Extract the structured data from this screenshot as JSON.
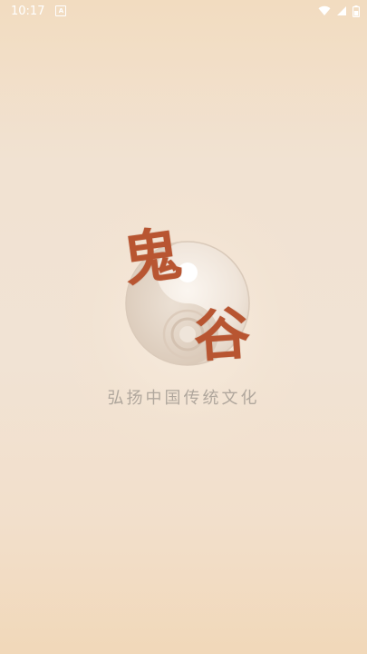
{
  "status_bar": {
    "time": "10:17",
    "notification_glyph": "A",
    "icons": [
      "wifi-icon",
      "signal-icon",
      "battery-icon"
    ]
  },
  "logo": {
    "char_1": "鬼",
    "char_2": "谷"
  },
  "slogan": "弘扬中国传统文化",
  "colors": {
    "brush_red": "#b85531",
    "slogan_gray": "#b0a79d",
    "background_top": "#f2dcc0",
    "background_bottom": "#f1d8b9"
  }
}
